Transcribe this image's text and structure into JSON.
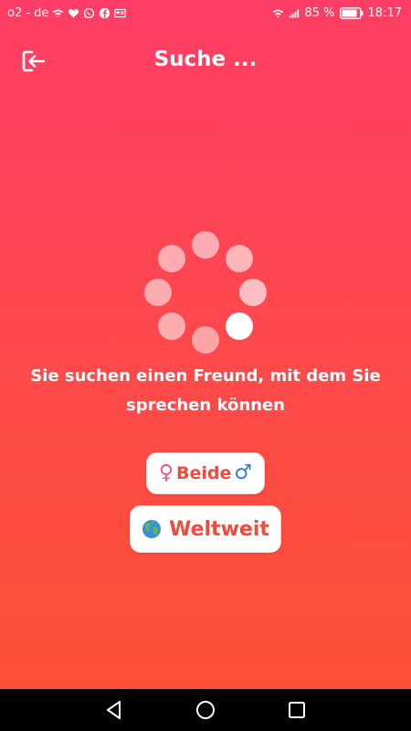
{
  "status_bar": {
    "carrier": "o2 - de",
    "battery": "85 %",
    "time": "18:17"
  },
  "header": {
    "title": "Suche ..."
  },
  "spinner": {
    "dot_count": 8,
    "active_index": 3
  },
  "message": {
    "text": "Sie suchen einen Freund, mit dem Sie sprechen können"
  },
  "filters": {
    "gender_label": "Beide",
    "female_symbol": "♀",
    "male_symbol": "♂",
    "region_label": "Weltweit"
  },
  "icons": {
    "exit": "exit-icon",
    "globe": "globe-icon",
    "nav_back": "back-triangle-icon",
    "nav_home": "home-circle-icon",
    "nav_recents": "recents-square-icon"
  },
  "colors": {
    "gradient_top": "#ff3d66",
    "gradient_bottom": "#ff4f33",
    "accent_text": "#f24a3c",
    "female": "#ff4f8b",
    "male": "#2e7dd6"
  }
}
